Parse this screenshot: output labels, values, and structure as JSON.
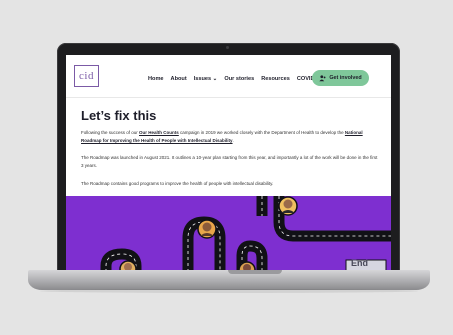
{
  "site": {
    "logo_text": "cid",
    "nav": [
      {
        "label": "Home"
      },
      {
        "label": "About"
      },
      {
        "label": "Issues ⌄"
      },
      {
        "label": "Our stories"
      },
      {
        "label": "Resources"
      },
      {
        "label": "COVID"
      }
    ],
    "cta_label": "Get involved",
    "accent_color": "#7fc79a",
    "brand_color": "#7b5aa6",
    "graphic_color": "#7e2fd0"
  },
  "content": {
    "heading": "Let’s fix this",
    "p1_a": "Following the success of our ",
    "p1_link1": "Our Health Counts",
    "p1_b": " campaign in 2019 we worked closely with the Department of Health to develop the ",
    "p1_link2": "National Roadmap for Improving the Health of People with Intellectual Disability",
    "p1_c": ".",
    "p2": "The Roadmap was launched in August 2021. It outlines a 10-year plan starting from this year, and importantly a lot of the work will be done in the first 3 years.",
    "p3": "The Roadmap contains good programs to improve the health of people with intellectual disability."
  },
  "graphic": {
    "sign_text": "End"
  }
}
